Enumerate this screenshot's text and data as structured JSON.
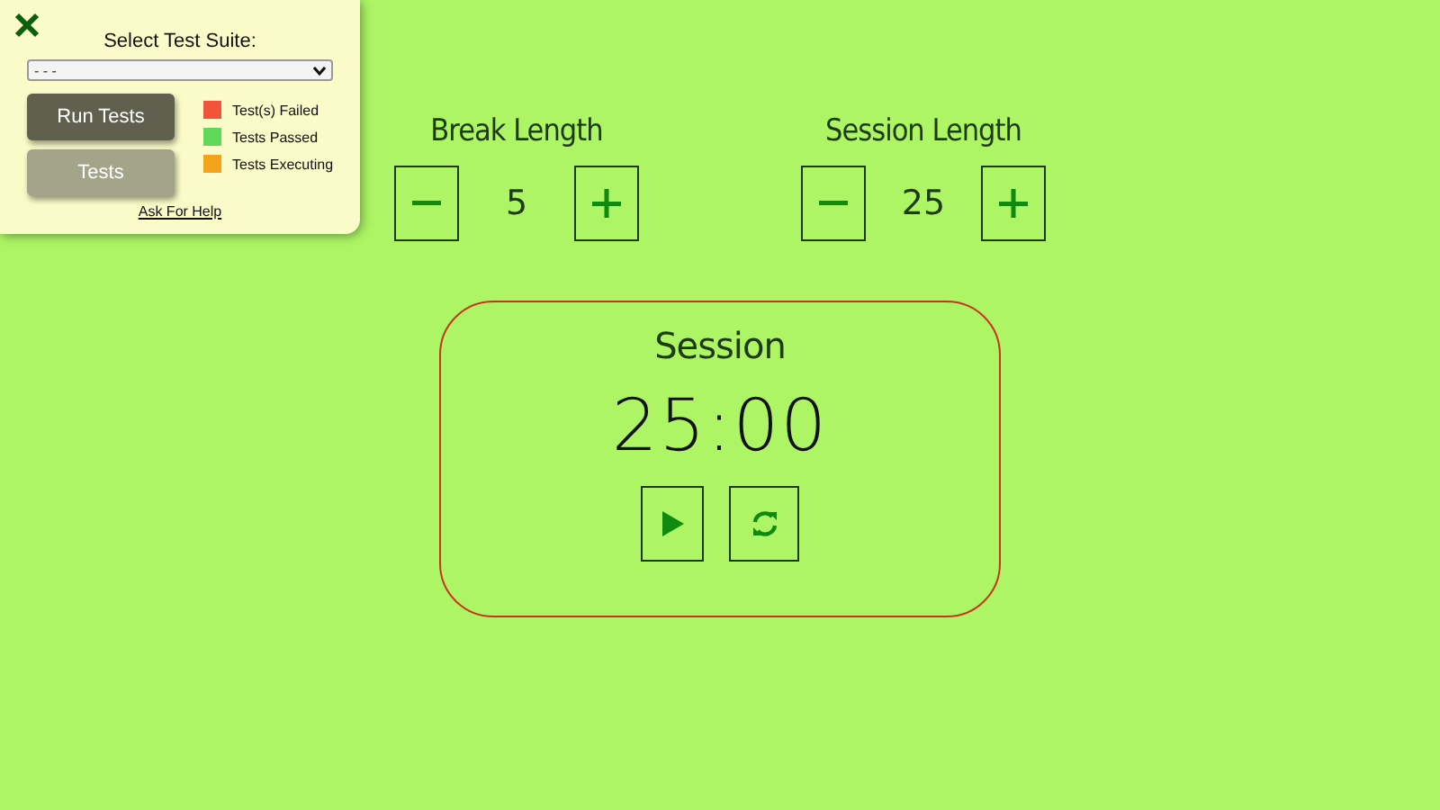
{
  "test_panel": {
    "title": "Select Test Suite:",
    "suite_select": {
      "value": "- - -"
    },
    "buttons": [
      "Run Tests",
      "Tests"
    ],
    "legend": [
      {
        "label": "Test(s) Failed",
        "color": "#f2533b"
      },
      {
        "label": "Tests Passed",
        "color": "#5fd85a"
      },
      {
        "label": "Tests Executing",
        "color": "#f5a31a"
      }
    ],
    "help_link": "Ask For Help"
  },
  "controls": [
    {
      "label": "Break Length",
      "value": "5"
    },
    {
      "label": "Session Length",
      "value": "25"
    }
  ],
  "timer": {
    "label": "Session",
    "time": "25:00"
  }
}
